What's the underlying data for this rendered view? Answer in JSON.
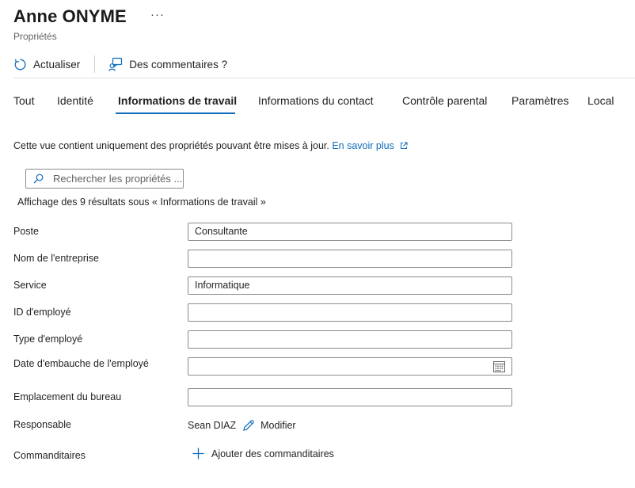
{
  "header": {
    "title": "Anne ONYME",
    "more": "···",
    "subtitle": "Propriétés"
  },
  "toolbar": {
    "refresh_label": "Actualiser",
    "feedback_label": "Des commentaires ?"
  },
  "tabs": [
    {
      "label": "Tout"
    },
    {
      "label": "Identité"
    },
    {
      "label": "Informations de travail",
      "active": true
    },
    {
      "label": "Informations du contact"
    },
    {
      "label": "Contrôle parental"
    },
    {
      "label": "Paramètres"
    },
    {
      "label": "Local"
    }
  ],
  "info": {
    "text": "Cette vue contient uniquement des propriétés pouvant être mises à jour. ",
    "link": "En savoir plus"
  },
  "search": {
    "placeholder": "Rechercher les propriétés ..."
  },
  "results_text": "Affichage des 9 résultats sous « Informations de travail »",
  "fields": {
    "poste": {
      "label": "Poste",
      "value": "Consultante"
    },
    "entreprise": {
      "label": "Nom de l'entreprise",
      "value": ""
    },
    "service": {
      "label": "Service",
      "value": "Informatique"
    },
    "id_employe": {
      "label": "ID d'employé",
      "value": ""
    },
    "type_employe": {
      "label": "Type d'employé",
      "value": ""
    },
    "date_embauche": {
      "label": "Date d'embauche de l'employé",
      "value": ""
    },
    "bureau": {
      "label": "Emplacement du bureau",
      "value": ""
    }
  },
  "manager": {
    "label": "Responsable",
    "name": "Sean DIAZ",
    "edit_label": "Modifier"
  },
  "sponsors": {
    "label": "Commanditaires",
    "add_label": "Ajouter des commanditaires"
  },
  "colors": {
    "accent": "#0f6cbd",
    "text": "#242424",
    "border": "#8a8a8a"
  }
}
